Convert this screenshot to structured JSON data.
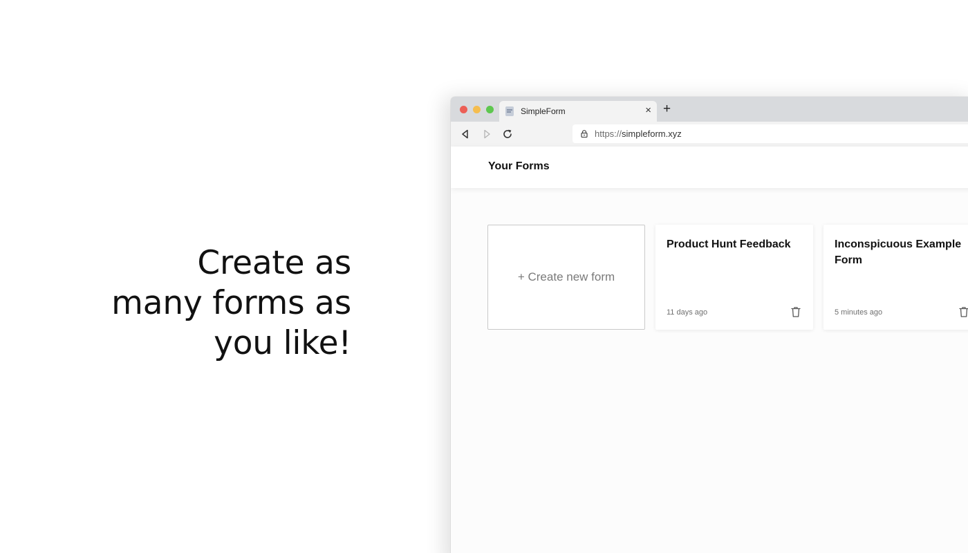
{
  "headline": {
    "lines": [
      "Create as",
      "many forms as",
      "you like!"
    ]
  },
  "browser": {
    "tab_title": "SimpleForm",
    "tab_close_glyph": "×",
    "new_tab_glyph": "+",
    "url_scheme": "https://",
    "url_host": "simpleform.xyz",
    "icons": {
      "favicon": "document-icon",
      "back": "back-arrow-icon",
      "forward": "forward-arrow-icon",
      "reload": "reload-icon",
      "lock": "lock-icon"
    },
    "colors": {
      "close": "#ec5f56",
      "minimize": "#f5bd4f",
      "maximize": "#5ec74f"
    }
  },
  "app": {
    "title": "Your Forms",
    "create_label": "+ Create new form",
    "forms": [
      {
        "title": "Product Hunt Feedback",
        "time": "11 days ago",
        "icon": "trash-icon"
      },
      {
        "title": "Inconspicuous Example Form",
        "time": "5 minutes ago",
        "icon": "trash-icon"
      }
    ]
  }
}
